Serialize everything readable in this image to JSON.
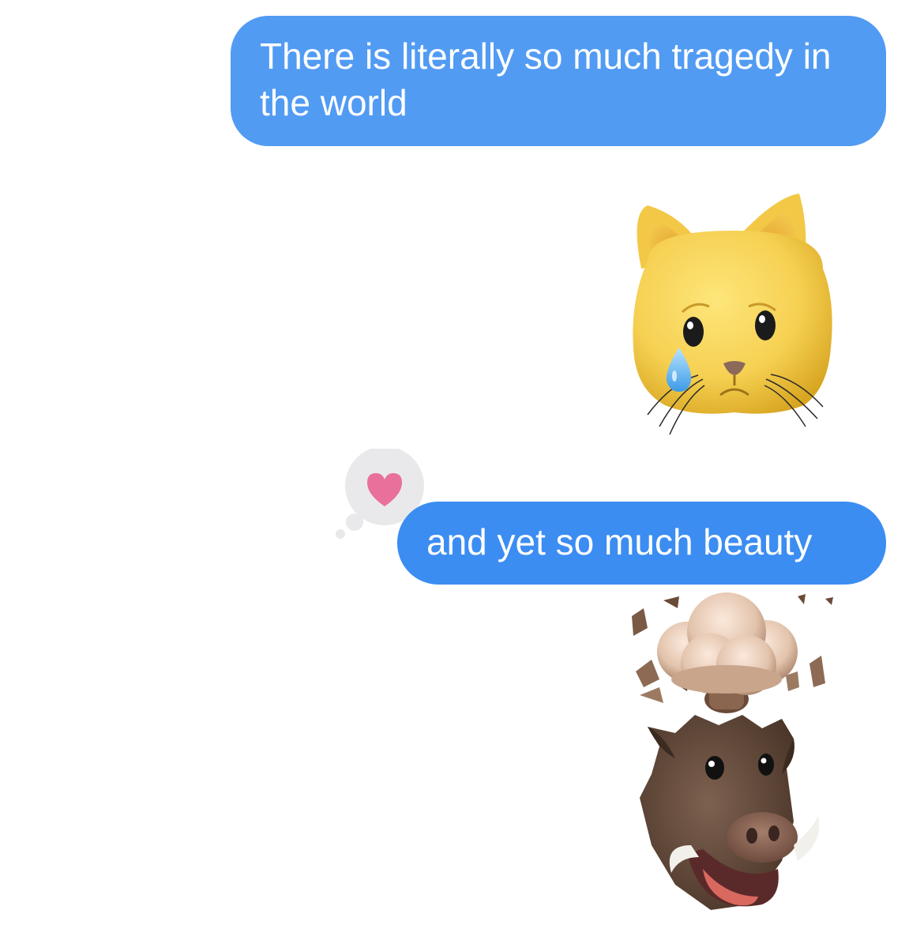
{
  "conversation": {
    "messages": [
      {
        "id": "m1",
        "sender": "me",
        "type": "text",
        "text": "There is literally so much tragedy in the world"
      },
      {
        "id": "m2",
        "sender": "me",
        "type": "animoji",
        "icon": "crying-cat-animoji"
      },
      {
        "id": "m3",
        "sender": "me",
        "type": "text",
        "text": "and yet so much beauty",
        "reaction": {
          "icon": "heart-tapback-icon",
          "color": "#e8709a"
        }
      },
      {
        "id": "m4",
        "sender": "me",
        "type": "animoji",
        "icon": "mind-blown-boar-animoji"
      }
    ]
  },
  "colors": {
    "bubble_blue": "#3b8df2",
    "background": "#ffffff",
    "tapback_bubble": "#e9e9eb"
  }
}
